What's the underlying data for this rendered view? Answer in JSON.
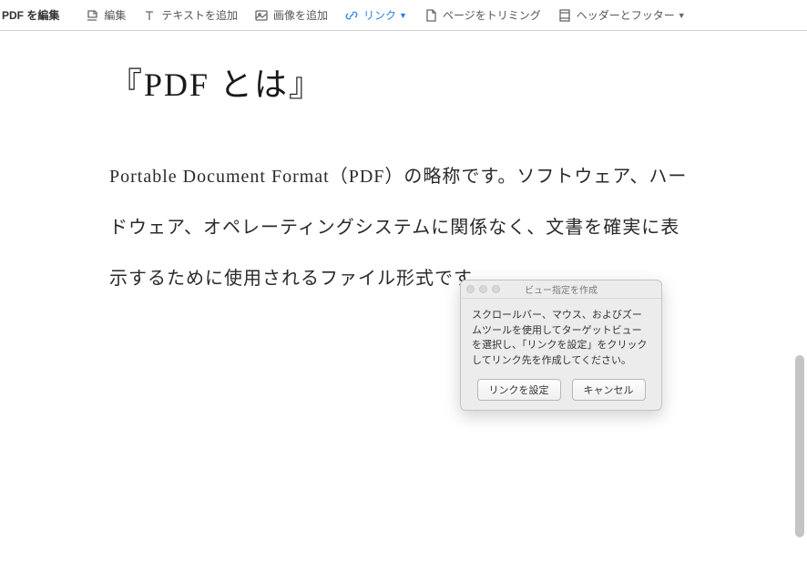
{
  "toolbar": {
    "title": "PDF を編集",
    "edit": "編集",
    "add_text": "テキストを追加",
    "add_image": "画像を追加",
    "link": "リンク",
    "trim_page": "ページをトリミング",
    "header_footer": "ヘッダーとフッター"
  },
  "document": {
    "title": "『PDF とは』",
    "body": "Portable Document Format（PDF）の略称です。ソフトウェア、ハードウェア、オペレーティングシステムに関係なく、文書を確実に表示するために使用されるファイル形式です。"
  },
  "dialog": {
    "title": "ビュー指定を作成",
    "message": "スクロールバー、マウス、およびズームツールを使用してターゲットビューを選択し、「リンクを設定」をクリックしてリンク先を作成してください。",
    "confirm": "リンクを設定",
    "cancel": "キャンセル"
  }
}
